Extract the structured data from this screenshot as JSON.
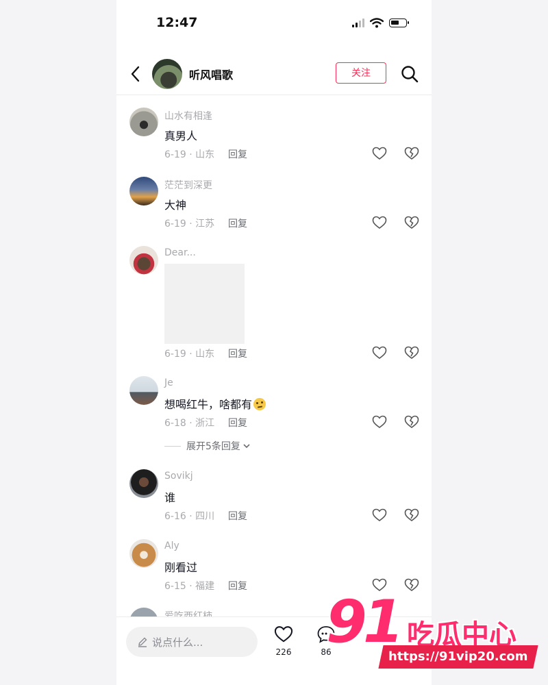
{
  "status_bar": {
    "time": "12:47"
  },
  "header": {
    "title": "听风唱歌",
    "follow_label": "关注"
  },
  "comments": [
    {
      "username": "山水有相逢",
      "text": "真男人",
      "date_location": "6-19 · 山东",
      "reply_label": "回复"
    },
    {
      "username": "茫茫到深更",
      "text": "大神",
      "date_location": "6-19 · 江苏",
      "reply_label": "回复"
    },
    {
      "username": "Dear...",
      "text": "",
      "date_location": "6-19 · 山东",
      "reply_label": "回复"
    },
    {
      "username": "Je",
      "text": "想喝红牛，啥都有",
      "date_location": "6-18 · 浙江",
      "reply_label": "回复",
      "expand_label": "展开5条回复"
    },
    {
      "username": "Sovikj",
      "text": "谁",
      "date_location": "6-16 · 四川",
      "reply_label": "回复"
    },
    {
      "username": "Aly",
      "text": "刚看过",
      "date_location": "6-15 · 福建",
      "reply_label": "回复"
    },
    {
      "username": "爱吃西红柿"
    }
  ],
  "bottom_bar": {
    "input_placeholder": "说点什么...",
    "likes": "226",
    "comments": "86"
  },
  "watermark": {
    "number": "91",
    "name": "吃瓜中心",
    "url": "https://91vip20.com"
  },
  "colors": {
    "accent": "#fe2c55",
    "secondary_text": "#a8a9ad",
    "watermark": "#ff2d6d"
  }
}
